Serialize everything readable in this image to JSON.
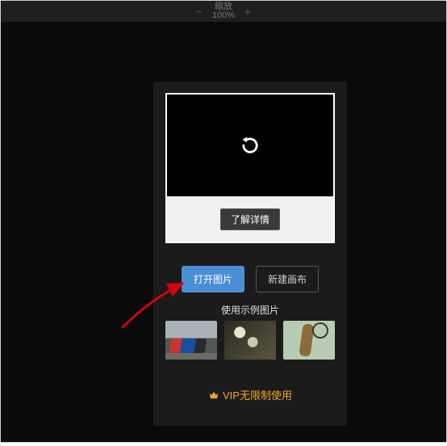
{
  "topbar": {
    "zoom_label": "缩放",
    "zoom_value": "100%",
    "minus": "−",
    "plus": "+"
  },
  "preview": {
    "details_label": "了解详情"
  },
  "actions": {
    "open_image": "打开图片",
    "new_canvas": "新建画布"
  },
  "samples": {
    "heading": "使用示例图片"
  },
  "vip": {
    "text": "VIP无限制使用"
  }
}
